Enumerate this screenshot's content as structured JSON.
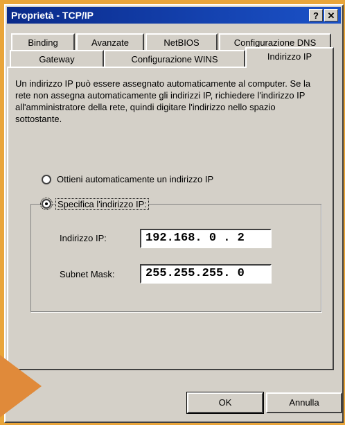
{
  "window": {
    "title": "Proprietà - TCP/IP",
    "help_button": "?",
    "close_button": "✕"
  },
  "tabs_row1": [
    "Binding",
    "Avanzate",
    "NetBIOS",
    "Configurazione DNS"
  ],
  "tabs_row2": [
    "Gateway",
    "Configurazione WINS",
    "Indirizzo IP"
  ],
  "active_tab": "Indirizzo IP",
  "description": "Un indirizzo IP può essere assegnato automaticamente al computer. Se la rete non assegna automaticamente gli indirizzi IP, richiedere l'indirizzo IP all'amministratore della rete, quindi digitare l'indirizzo nello spazio sottostante.",
  "options": {
    "auto": "Ottieni automaticamente un indirizzo IP",
    "manual": "Specifica l'indirizzo IP:",
    "selected": "manual"
  },
  "fields": {
    "ip_label": "Indirizzo IP:",
    "ip_value": "192.168. 0 . 2",
    "mask_label": "Subnet Mask:",
    "mask_value": "255.255.255. 0"
  },
  "buttons": {
    "ok": "OK",
    "cancel": "Annulla"
  },
  "colors": {
    "background": "#e9a53a",
    "titlebar": "#0a2a8a",
    "arrow": "#e08a3a"
  }
}
